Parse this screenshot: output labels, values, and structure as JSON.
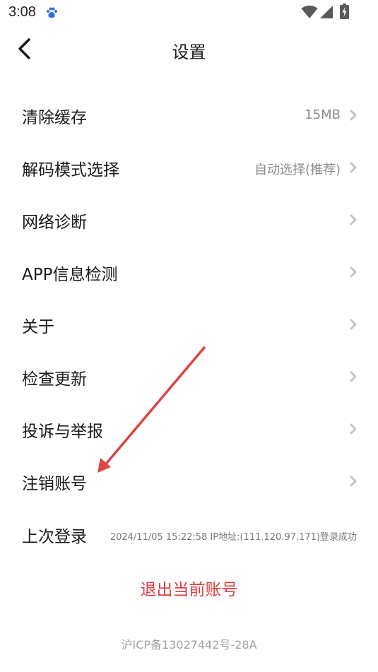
{
  "status_bar": {
    "time": "3:08",
    "app_icon": "baidu-paw-icon",
    "wifi_icon": "wifi-icon",
    "signal_icon": "signal-icon",
    "battery_icon": "battery-charging-icon"
  },
  "header": {
    "title": "设置",
    "back_icon": "chevron-left-icon"
  },
  "settings": [
    {
      "label": "清除缓存",
      "value": "15MB"
    },
    {
      "label": "解码模式选择",
      "value": "自动选择(推荐)"
    },
    {
      "label": "网络诊断",
      "value": ""
    },
    {
      "label": "APP信息检测",
      "value": ""
    },
    {
      "label": "关于",
      "value": ""
    },
    {
      "label": "检查更新",
      "value": ""
    },
    {
      "label": "投诉与举报",
      "value": ""
    },
    {
      "label": "注销账号",
      "value": ""
    }
  ],
  "last_login": {
    "label": "上次登录",
    "info": "2024/11/05 15:22:58  IP地址:(111.120.97.171)登录成功"
  },
  "logout": {
    "label": "退出当前账号"
  },
  "footer": {
    "icp": "沪ICP备13027442号-28A"
  },
  "colors": {
    "accent_red": "#e03c3c",
    "annotation_arrow": "#d94444",
    "chevron": "#c4c4c4",
    "secondary_text": "#8a8a8a"
  }
}
